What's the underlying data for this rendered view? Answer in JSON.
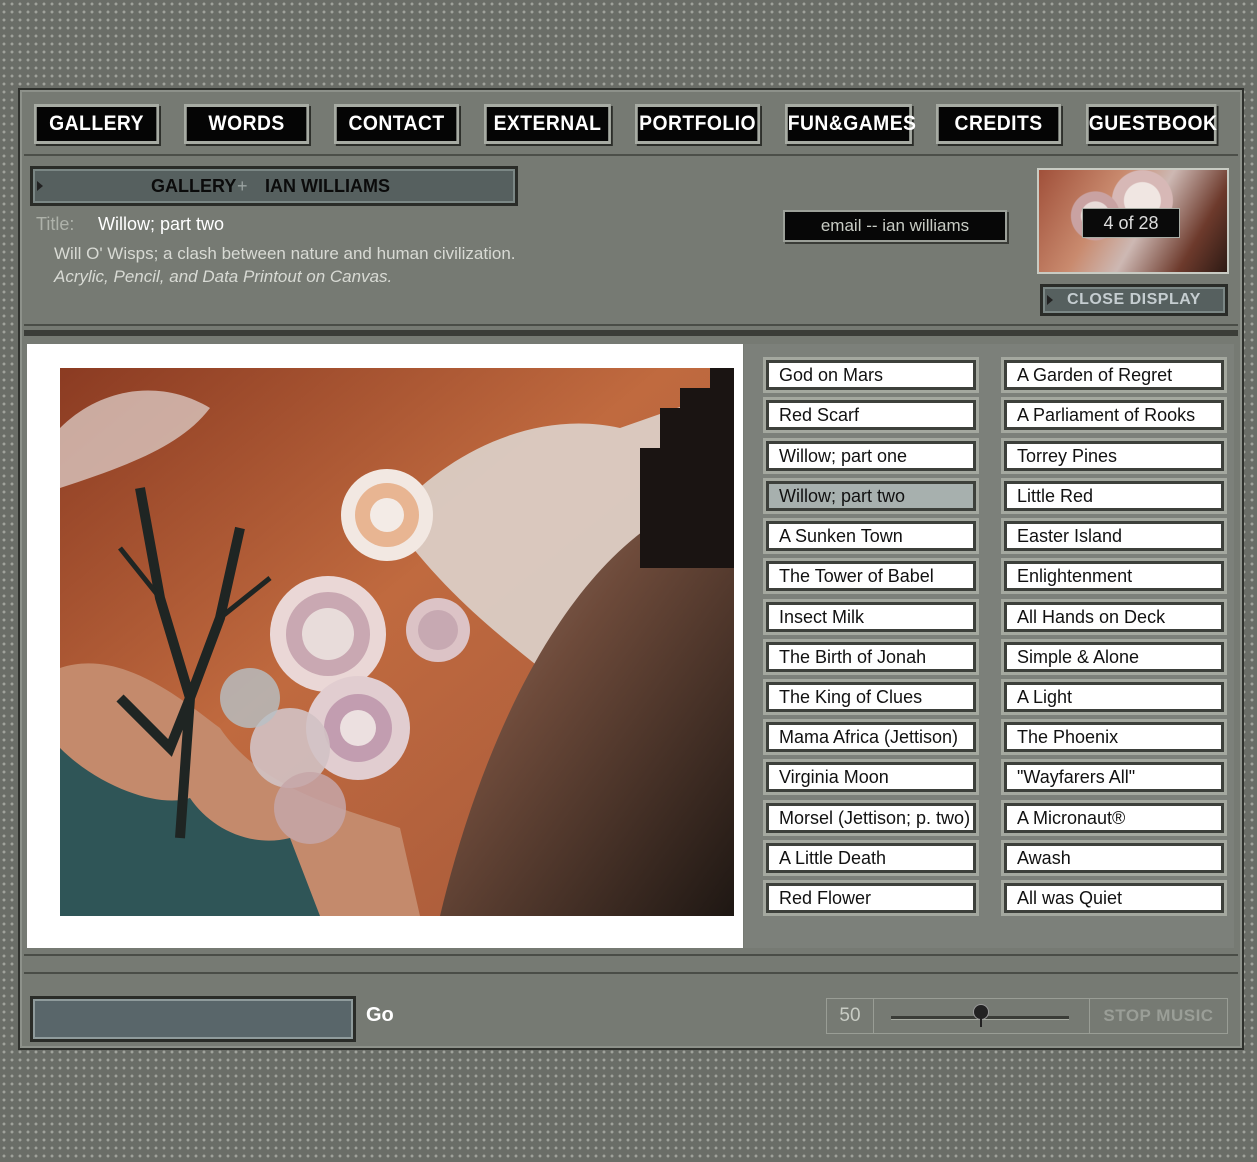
{
  "nav": {
    "items": [
      "GALLERY",
      "WORDS",
      "CONTACT",
      "EXTERNAL",
      "PORTFOLIO",
      "FUN&GAMES",
      "CREDITS",
      "GUESTBOOK"
    ]
  },
  "breadcrumb": {
    "section": "GALLERY",
    "separator": "+",
    "artist": "IAN WILLIAMS"
  },
  "artwork": {
    "title_label": "Title:",
    "title": "Willow; part two",
    "description": "Will O' Wisps; a clash between nature and human civilization.",
    "medium": "Acrylic, Pencil, and Data Printout on Canvas."
  },
  "email_label": "email -- ian williams",
  "counter": "4  of 28",
  "close_label": "CLOSE DISPLAY",
  "list": {
    "left": [
      "God on Mars",
      "Red Scarf",
      "Willow; part one",
      "Willow; part two",
      "A Sunken Town",
      "The Tower of Babel",
      "Insect Milk",
      "The Birth of Jonah",
      "The King of Clues",
      "Mama Africa (Jettison)",
      "Virginia Moon",
      "Morsel (Jettison; p. two)",
      "A Little Death",
      "Red Flower"
    ],
    "right": [
      "A Garden of Regret",
      "A Parliament of Rooks",
      "Torrey Pines",
      "Little Red",
      "Easter Island",
      "Enlightenment",
      "All Hands on Deck",
      "Simple & Alone",
      "A Light",
      "The Phoenix",
      "\"Wayfarers All\"",
      "A Micronaut®",
      "Awash",
      "All was Quiet"
    ],
    "selected": "Willow; part two"
  },
  "footer": {
    "go_label": "Go",
    "volume": "50",
    "stop_label": "STOP MUSIC"
  },
  "colors": {
    "frame": "#767a73",
    "button_bg": "#050505",
    "panel_blue": "#56605f"
  }
}
